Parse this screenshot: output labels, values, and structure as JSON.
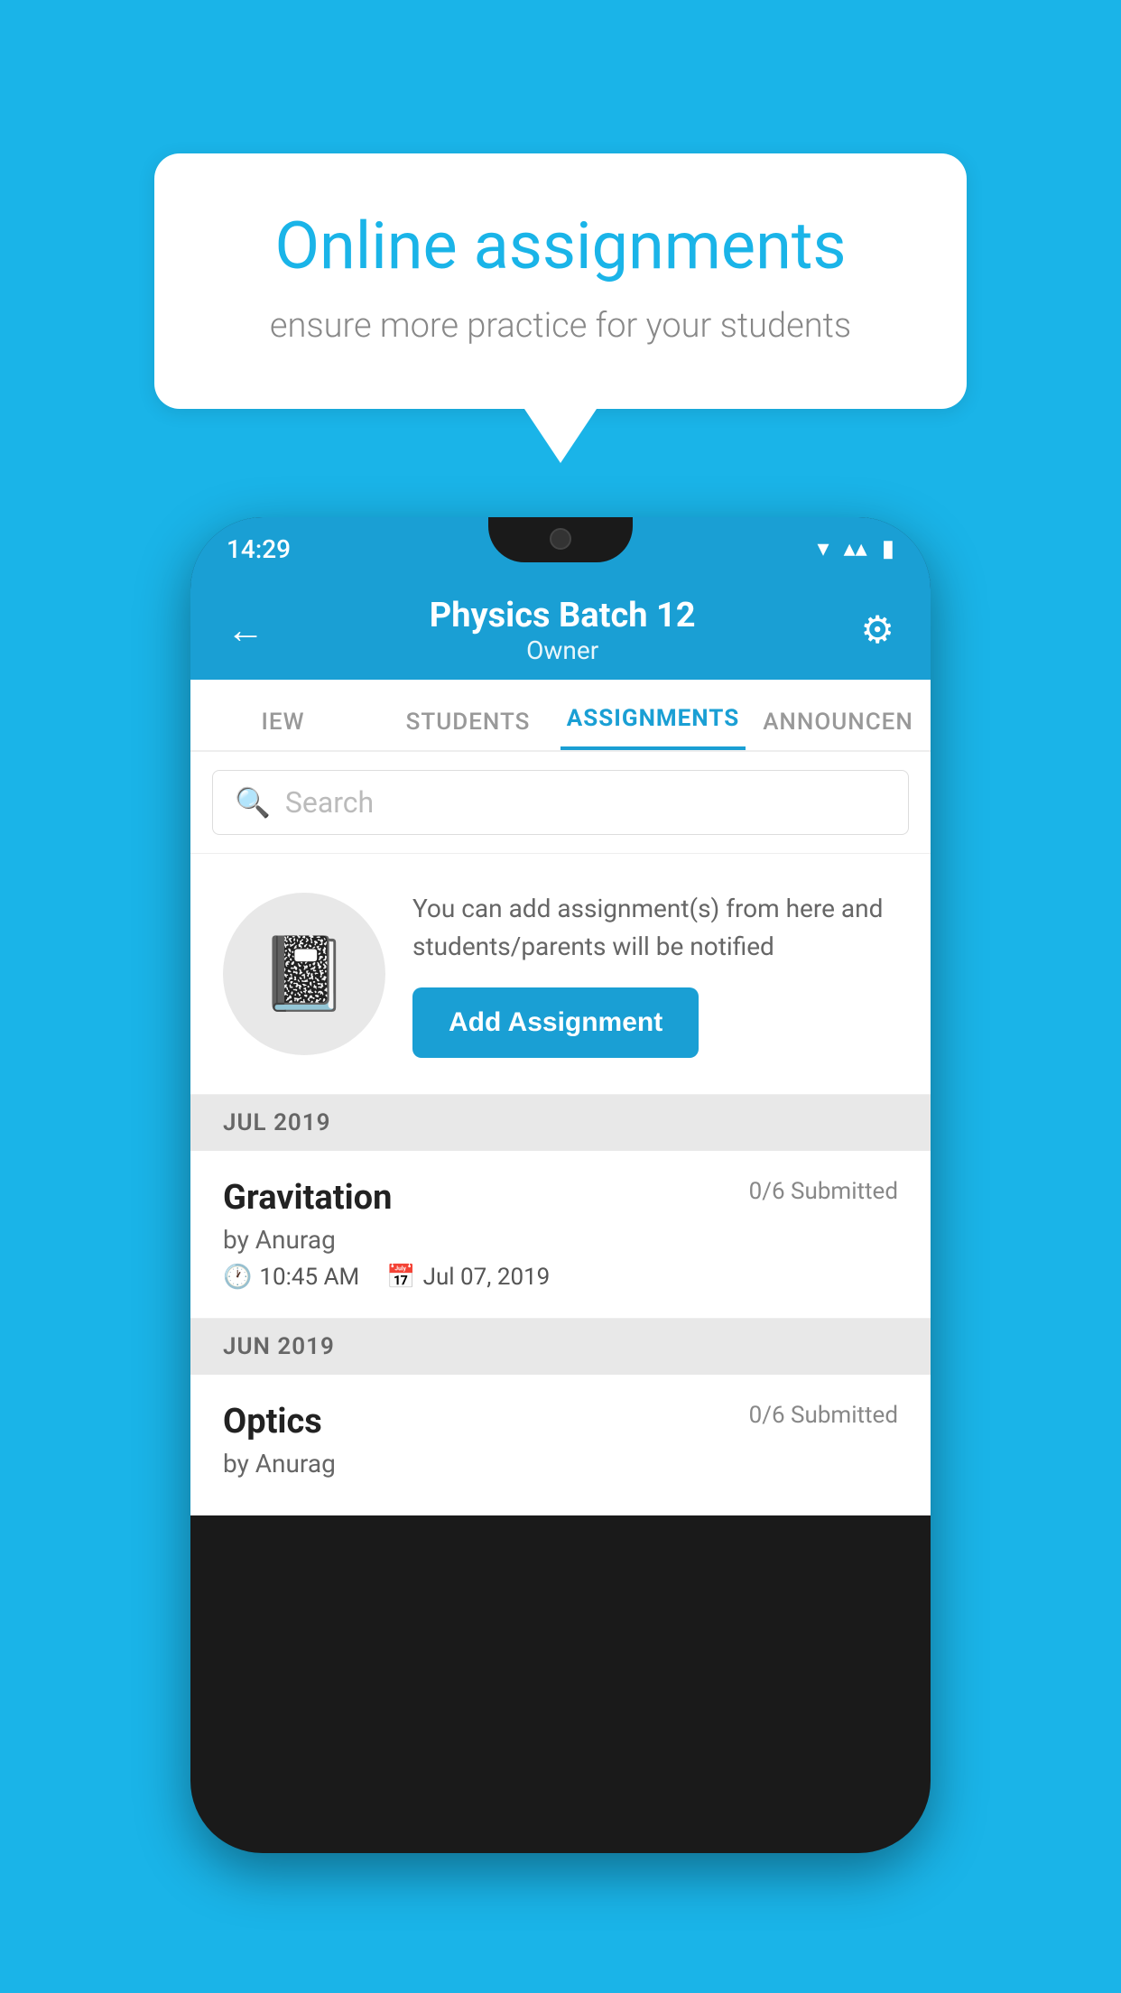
{
  "background_color": "#1ab4e8",
  "speech_bubble": {
    "title": "Online assignments",
    "subtitle": "ensure more practice for your students"
  },
  "phone": {
    "status_bar": {
      "time": "14:29"
    },
    "header": {
      "title": "Physics Batch 12",
      "subtitle": "Owner",
      "back_label": "←",
      "gear_label": "⚙"
    },
    "tabs": [
      {
        "label": "IEW",
        "active": false
      },
      {
        "label": "STUDENTS",
        "active": false
      },
      {
        "label": "ASSIGNMENTS",
        "active": true
      },
      {
        "label": "ANNOUNCER",
        "active": false
      }
    ],
    "search": {
      "placeholder": "Search"
    },
    "empty_state": {
      "description": "You can add assignment(s) from here and students/parents will be notified",
      "button_label": "Add Assignment"
    },
    "sections": [
      {
        "header": "JUL 2019",
        "assignments": [
          {
            "name": "Gravitation",
            "submitted": "0/6 Submitted",
            "author": "by Anurag",
            "time": "10:45 AM",
            "date": "Jul 07, 2019"
          }
        ]
      },
      {
        "header": "JUN 2019",
        "assignments": [
          {
            "name": "Optics",
            "submitted": "0/6 Submitted",
            "author": "by Anurag",
            "time": "",
            "date": ""
          }
        ]
      }
    ]
  }
}
